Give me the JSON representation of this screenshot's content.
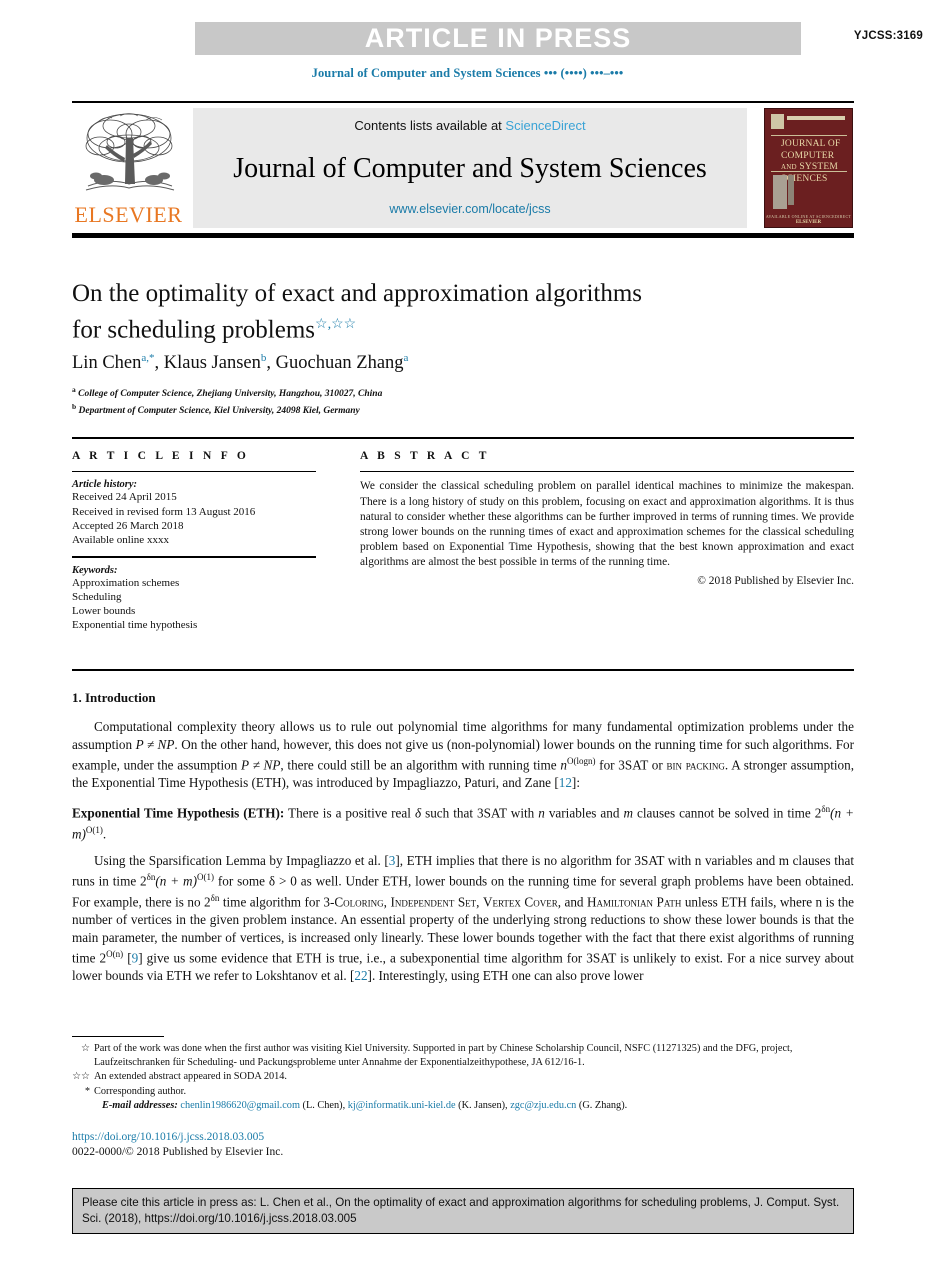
{
  "banner": {
    "text": "ARTICLE IN PRESS",
    "article_id": "YJCSS:3169",
    "bar_color": "#c8c8c8"
  },
  "running_head": "Journal of Computer and System Sciences ••• (••••) •••–•••",
  "masthead": {
    "publisher": "ELSEVIER",
    "publisher_color": "#e87722",
    "contents_prefix": "Contents lists available at ",
    "contents_link": "ScienceDirect",
    "journal_name": "Journal of Computer and System Sciences",
    "url": "www.elsevier.com/locate/jcss",
    "cover": {
      "line1": "JOURNAL OF",
      "line2": "COMPUTER",
      "line3_small": "AND",
      "line3": "SYSTEM",
      "line4": "SCIENCES",
      "footer_small": "AVAILABLE ONLINE AT SCIENCEDIRECT",
      "footer": "ELSEVIER",
      "background": "#6b1f20"
    }
  },
  "article": {
    "title_line1": "On the optimality of exact and approximation algorithms",
    "title_line2": "for scheduling problems",
    "title_marks": "☆,☆☆",
    "authors_parts": [
      {
        "name": "Lin Chen",
        "sup": "a,*"
      },
      {
        "name": "Klaus Jansen",
        "sup": "b"
      },
      {
        "name": "Guochuan Zhang",
        "sup": "a"
      }
    ],
    "affiliations": [
      {
        "mark": "a",
        "text": "College of Computer Science, Zhejiang University, Hangzhou, 310027, China"
      },
      {
        "mark": "b",
        "text": "Department of Computer Science, Kiel University, 24098 Kiel, Germany"
      }
    ]
  },
  "info": {
    "heading": "A R T I C L E   I N F O",
    "history_label": "Article history:",
    "history": [
      "Received 24 April 2015",
      "Received in revised form 13 August 2016",
      "Accepted 26 March 2018",
      "Available online xxxx"
    ],
    "keywords_label": "Keywords:",
    "keywords": [
      "Approximation schemes",
      "Scheduling",
      "Lower bounds",
      "Exponential time hypothesis"
    ]
  },
  "abstract": {
    "heading": "A B S T R A C T",
    "text": "We consider the classical scheduling problem on parallel identical machines to minimize the makespan. There is a long history of study on this problem, focusing on exact and approximation algorithms. It is thus natural to consider whether these algorithms can be further improved in terms of running times. We provide strong lower bounds on the running times of exact and approximation schemes for the classical scheduling problem based on Exponential Time Hypothesis, showing that the best known approximation and exact algorithms are almost the best possible in terms of the running time.",
    "copyright": "© 2018 Published by Elsevier Inc."
  },
  "body": {
    "section_title": "1. Introduction",
    "paragraph1_a": "Computational complexity theory allows us to rule out polynomial time algorithms for many fundamental optimization problems under the assumption ",
    "p1_math1": "P ≠ NP",
    "paragraph1_b": ". On the other hand, however, this does not give us (non-polynomial) lower bounds on the running time for such algorithms. For example, under the assumption ",
    "p1_math2": "P ≠ NP",
    "paragraph1_c": ", there could still be an algorithm with running time ",
    "p1_math3": "n",
    "p1_sup3": "O(logn)",
    "paragraph1_d": " for 3SAT or ",
    "p1_sc": "bin packing",
    "paragraph1_e": ". A stronger assumption, the Exponential Time Hypothesis (ETH), was introduced by Impagliazzo, Paturi, and Zane [",
    "p1_ref": "12",
    "paragraph1_f": "]:",
    "eth_label": "Exponential Time Hypothesis (ETH):",
    "eth_a": " There is a positive real ",
    "eth_delta": "δ",
    "eth_b": " such that 3SAT with ",
    "eth_n": "n",
    "eth_c": " variables and ",
    "eth_m": "m",
    "eth_d": " clauses cannot be solved in time 2",
    "eth_sup1": "δn",
    "eth_e": "(n + m)",
    "eth_sup2": "O(1)",
    "eth_f": ".",
    "paragraph3_a": "Using the Sparsification Lemma by Impagliazzo et al. [",
    "p3_ref1": "3",
    "paragraph3_b": "], ETH implies that there is no algorithm for 3SAT with n variables and m clauses that runs in time 2",
    "p3_sup1": "δn",
    "paragraph3_c": "(n + m)",
    "p3_sup2": "O(1)",
    "paragraph3_d": " for some δ > 0 as well. Under ETH, lower bounds on the running time for several graph problems have been obtained. For example, there is no 2",
    "p3_sup3": "δn",
    "paragraph3_e": " time algorithm for 3-",
    "p3_sc1": "Coloring",
    "paragraph3_f": ", ",
    "p3_sc2": "Independent Set",
    "paragraph3_g": ", ",
    "p3_sc3": "Vertex Cover",
    "paragraph3_h": ", and ",
    "p3_sc4": "Hamiltonian Path",
    "paragraph3_i": " unless ETH fails, where n is the number of vertices in the given problem instance. An essential property of the underlying strong reductions to show these lower bounds is that the main parameter, the number of vertices, is increased only linearly. These lower bounds together with the fact that there exist algorithms of running time 2",
    "p3_sup4": "O(n)",
    "paragraph3_j": " [",
    "p3_ref2": "9",
    "paragraph3_k": "] give us some evidence that ETH is true, i.e., a subexponential time algorithm for 3SAT is unlikely to exist. For a nice survey about lower bounds via ETH we refer to Lokshtanov et al. [",
    "p3_ref3": "22",
    "paragraph3_l": "]. Interestingly, using ETH one can also prove lower"
  },
  "footnotes": [
    {
      "mark": "☆",
      "text": "Part of the work was done when the first author was visiting Kiel University. Supported in part by Chinese Scholarship Council, NSFC (11271325) and the DFG, project, Laufzeitschranken für Scheduling- und Packungsprobleme unter Annahme der Exponentialzeithypothese, JA 612/16-1."
    },
    {
      "mark": "☆☆",
      "text": "An extended abstract appeared in SODA 2014."
    },
    {
      "mark": "*",
      "text": "Corresponding author."
    }
  ],
  "emails": {
    "label": "E-mail addresses:",
    "entries": [
      {
        "address": "chenlin1986620@gmail.com",
        "owner": " (L. Chen), "
      },
      {
        "address": "kj@informatik.uni-kiel.de",
        "owner": " (K. Jansen), "
      },
      {
        "address": "zgc@zju.edu.cn",
        "owner": " (G. Zhang)."
      }
    ]
  },
  "doi": "https://doi.org/10.1016/j.jcss.2018.03.005",
  "copyright_line": "0022-0000/© 2018 Published by Elsevier Inc.",
  "cite_box": "Please cite this article in press as: L. Chen et al., On the optimality of exact and approximation algorithms for scheduling problems, J. Comput. Syst. Sci. (2018), https://doi.org/10.1016/j.jcss.2018.03.005",
  "colors": {
    "link": "#1a7ba8",
    "sciencedirect": "#3aa3d6",
    "elsevier_orange": "#e87722",
    "cover_maroon": "#6b1f20"
  }
}
